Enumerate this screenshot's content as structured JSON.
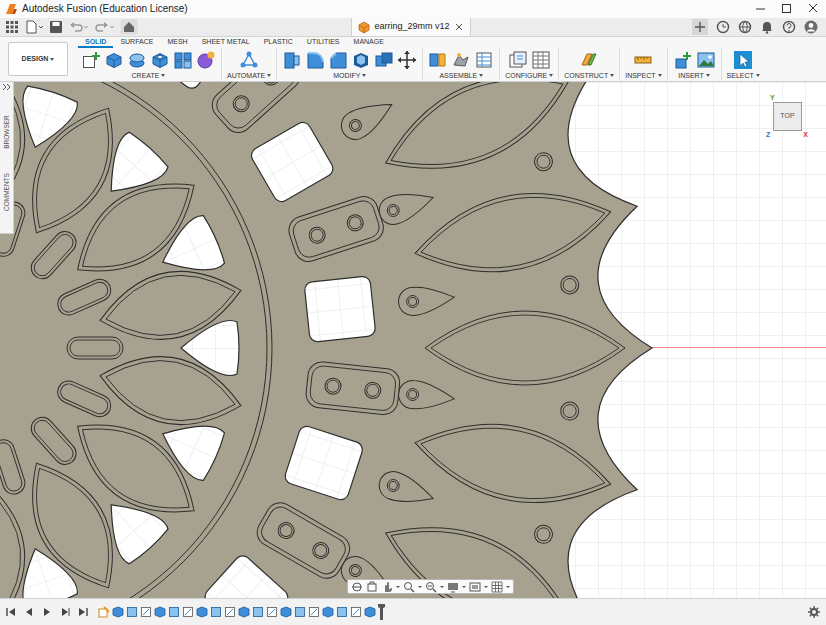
{
  "window": {
    "title": "Autodesk Fusion (Education License)"
  },
  "document": {
    "title": "earring_29mm v12"
  },
  "workspace": {
    "label": "DESIGN"
  },
  "toolbar_tabs": [
    {
      "label": "SOLID",
      "selected": true
    },
    {
      "label": "SURFACE",
      "selected": false
    },
    {
      "label": "MESH",
      "selected": false
    },
    {
      "label": "SHEET METAL",
      "selected": false
    },
    {
      "label": "PLASTIC",
      "selected": false
    },
    {
      "label": "UTILITIES",
      "selected": false
    },
    {
      "label": "MANAGE",
      "selected": false
    }
  ],
  "tool_groups": [
    "CREATE",
    "AUTOMATE",
    "MODIFY",
    "ASSEMBLE",
    "CONFIGURE",
    "CONSTRUCT",
    "INSPECT",
    "INSERT",
    "SELECT"
  ],
  "side_tabs": [
    "BROWSER",
    "COMMENTS"
  ],
  "view_cube": {
    "face": "TOP",
    "axes": [
      {
        "label": "Y",
        "color": "#4f9a2c"
      },
      {
        "label": "X",
        "color": "#d9363e"
      },
      {
        "label": "Z",
        "color": "#2f6fd6"
      }
    ]
  }
}
